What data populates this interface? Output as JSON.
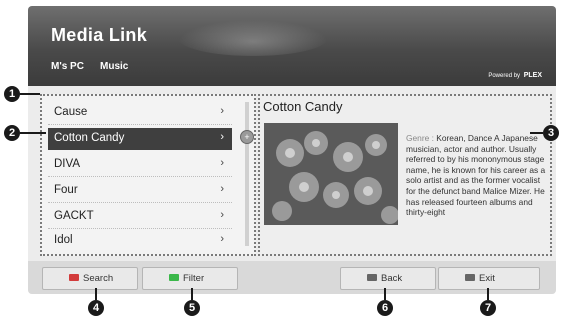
{
  "header": {
    "title": "Media Link",
    "breadcrumb": [
      "M's PC",
      "Music"
    ],
    "powered_by_prefix": "Powered by",
    "powered_by_brand": "PLEX"
  },
  "list": {
    "items": [
      {
        "label": "Cause",
        "selected": false
      },
      {
        "label": "Cotton Candy",
        "selected": true
      },
      {
        "label": "DIVA",
        "selected": false
      },
      {
        "label": "Four",
        "selected": false
      },
      {
        "label": "GACKT",
        "selected": false
      },
      {
        "label": "Idol",
        "selected": false
      }
    ],
    "chevron": "›"
  },
  "detail": {
    "title": "Cotton Candy",
    "genre_label": "Genre :",
    "genre_value": "Korean, Dance",
    "description": "A Japanese musician, actor and author. Usually referred to by his mononymous stage name, he is known for his career as a solo artist and as the former vocalist for the defunct band Malice Mizer. He has released fourteen albums and thirty-eight"
  },
  "bottom_bar": {
    "search_label": "Search",
    "filter_label": "Filter",
    "back_label": "Back",
    "exit_label": "Exit"
  },
  "callouts": [
    "1",
    "2",
    "3",
    "4",
    "5",
    "6",
    "7"
  ],
  "colors": {
    "search_key": "#d23b3b",
    "filter_key": "#3bb84a",
    "selection": "#3f3f3f"
  }
}
